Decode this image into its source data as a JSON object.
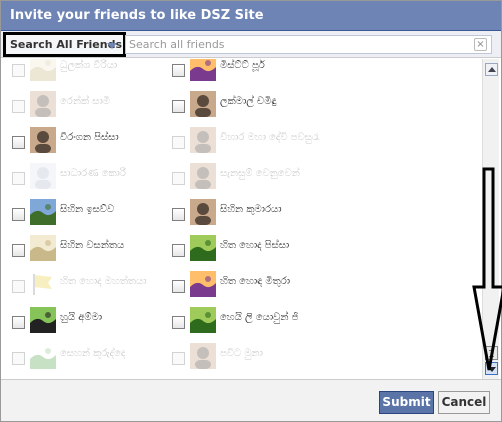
{
  "dialog": {
    "title": "Invite your friends to like DSZ Site",
    "filter_label": "Search All Friends",
    "search_placeholder": "Search all friends",
    "submit_label": "Submit",
    "cancel_label": "Cancel"
  },
  "friends": [
    {
      "name": "ධුලක්ශ වීරියා",
      "enabled": false,
      "icon": "avatar-cartoon-icon"
    },
    {
      "name": "මිස්ට්ට් පූර්",
      "enabled": true,
      "icon": "avatar-sunset-icon"
    },
    {
      "name": "රෙන්ක් සාමි",
      "enabled": false,
      "icon": "avatar-person-icon"
    },
    {
      "name": "ලක්මාල් චමිඳු",
      "enabled": true,
      "icon": "avatar-person-icon"
    },
    {
      "name": "වීරංගන පිස්සා",
      "enabled": true,
      "icon": "avatar-person-icon"
    },
    {
      "name": "විහාර මහා දේවි පවසුරැ",
      "enabled": false,
      "icon": "avatar-person-icon"
    },
    {
      "name": "සාධාරණ කොරි",
      "enabled": false,
      "icon": "avatar-default-icon"
    },
    {
      "name": "සැනසුම් වෙනුවෙන්",
      "enabled": false,
      "icon": "avatar-person-icon"
    },
    {
      "name": "සිහින ඉසව්ව",
      "enabled": true,
      "icon": "avatar-landscape-icon"
    },
    {
      "name": "සිහින කුමාරයා",
      "enabled": true,
      "icon": "avatar-person-icon"
    },
    {
      "name": "සිහින වසන්තය",
      "enabled": true,
      "icon": "avatar-cartoon-icon"
    },
    {
      "name": "හිත හොද පිස්සා",
      "enabled": true,
      "icon": "avatar-leaf-icon"
    },
    {
      "name": "හිත හොද මහත්තයා",
      "enabled": false,
      "icon": "avatar-flag-icon"
    },
    {
      "name": "හිත හොඳ මිතුරා",
      "enabled": true,
      "icon": "avatar-sunset-icon"
    },
    {
      "name": "හුයි අම්මා",
      "enabled": true,
      "icon": "avatar-cow-icon"
    },
    {
      "name": "හෙයි ලි යොවුන් ජි",
      "enabled": true,
      "icon": "avatar-leaf-icon"
    },
    {
      "name": "සෙහන් කුරුද්දෙ",
      "enabled": false,
      "icon": "avatar-dragon-icon"
    },
    {
      "name": "පවිට මුනා",
      "enabled": false,
      "icon": "avatar-person-icon"
    }
  ],
  "colors": {
    "title_bar": "#6d84b4",
    "submit": "#5b74a8",
    "annotation_arrow": "#000000"
  }
}
